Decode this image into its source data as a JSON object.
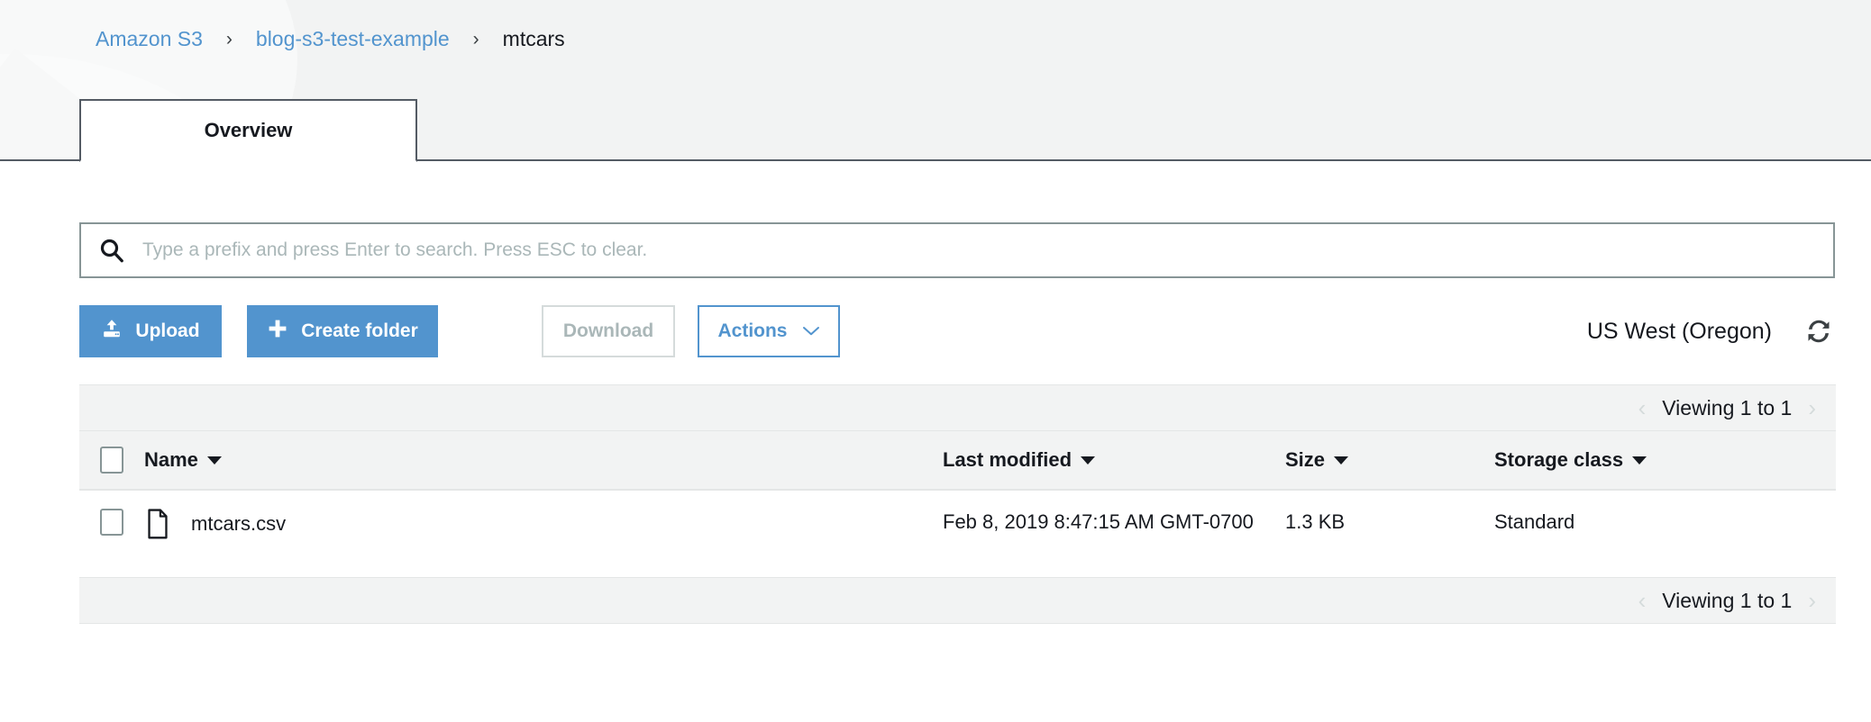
{
  "breadcrumb": {
    "separator": "›",
    "items": [
      {
        "label": "Amazon S3",
        "link": true
      },
      {
        "label": "blog-s3-test-example",
        "link": true
      },
      {
        "label": "mtcars",
        "link": false
      }
    ]
  },
  "tabs": [
    {
      "label": "Overview",
      "active": true
    }
  ],
  "search": {
    "placeholder": "Type a prefix and press Enter to search. Press ESC to clear.",
    "value": "",
    "icon": "search-icon"
  },
  "toolbar": {
    "upload_label": "Upload",
    "upload_icon": "upload-icon",
    "create_folder_label": "Create folder",
    "create_folder_icon": "plus-icon",
    "download_label": "Download",
    "download_disabled": true,
    "actions_label": "Actions",
    "actions_icon": "chevron-down-icon",
    "region_label": "US West (Oregon)",
    "refresh_icon": "refresh-icon"
  },
  "pagination": {
    "text": "Viewing 1 to 1",
    "prev_icon": "chevron-left-icon",
    "prev_glyph": "‹",
    "next_icon": "chevron-right-icon",
    "next_glyph": "›"
  },
  "table": {
    "columns": [
      {
        "label": "Name",
        "sortable": true
      },
      {
        "label": "Last modified",
        "sortable": true
      },
      {
        "label": "Size",
        "sortable": true
      },
      {
        "label": "Storage class",
        "sortable": true
      }
    ],
    "rows": [
      {
        "selected": false,
        "icon": "file-icon",
        "name": "mtcars.csv",
        "last_modified": "Feb 8, 2019 8:47:15 AM GMT-0700",
        "size": "1.3 KB",
        "storage_class": "Standard"
      }
    ]
  },
  "colors": {
    "accent_blue": "#5294ce",
    "link_blue": "#5294ce",
    "band_gray": "#f2f3f3",
    "border_dark": "#545b64",
    "disabled_gray": "#aab7b8",
    "text_dark": "#16191f"
  }
}
